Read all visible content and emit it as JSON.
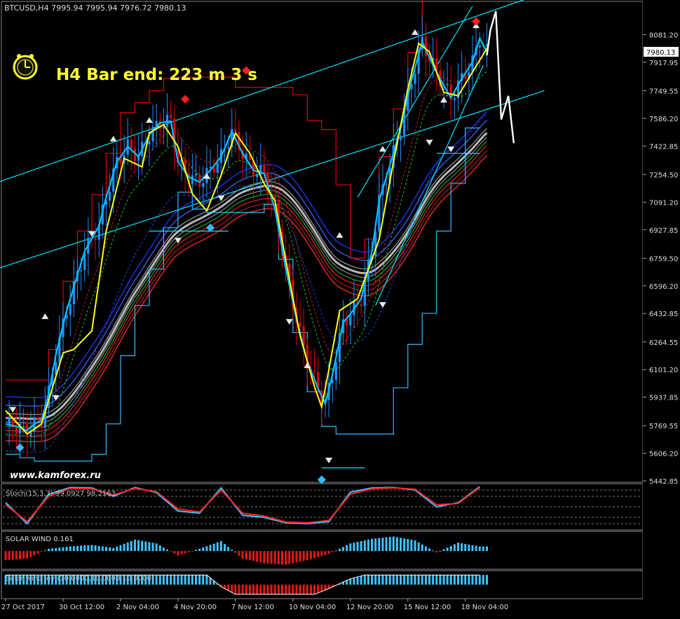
{
  "window": {
    "symbol_header": "BTCUSD,H4  7995.94 7995.94 7976.72 7980.13",
    "bar_end_label": "H4 Bar end: 223 m 3 s",
    "watermark": "www.kamforex.ru",
    "clock_icon": "clock-icon"
  },
  "colors": {
    "background": "#000000",
    "price_line": "#00bfff",
    "zigzag": "#ffff00",
    "channel": "#00e5ff",
    "envelope_upper": "#e00000",
    "envelope_lower": "#33bbff",
    "forecast": "#ffffff",
    "bull": "#1e90ff",
    "bear": "#e00000",
    "label_text": "#ffff33",
    "axis_text": "#dddddd"
  },
  "chart_data": [
    {
      "type": "line",
      "panel": "price",
      "ylim": [
        5442.85,
        8245.0
      ],
      "y_ticks": [
        8081.2,
        7917.95,
        7749.55,
        7586.2,
        7422.85,
        7254.5,
        7091.2,
        6927.85,
        6759.5,
        6596.2,
        6432.85,
        6264.55,
        6101.2,
        5937.85,
        5769.55,
        5606.2,
        5442.85
      ],
      "current_price": 7980.13,
      "x_ticks": [
        "27 Oct 2017",
        "30 Oct 12:00",
        "2 Nov 04:00",
        "4 Nov 20:00",
        "7 Nov 12:00",
        "10 Nov 04:00",
        "12 Nov 20:00",
        "15 Nov 12:00",
        "18 Nov 04:00"
      ],
      "x_range": [
        0,
        138
      ],
      "series": [
        {
          "role": "price",
          "x": [
            0,
            4,
            6,
            8,
            10,
            12,
            14,
            17,
            19,
            22,
            26,
            28,
            31,
            34,
            37,
            40,
            43,
            46,
            48,
            51,
            54,
            57,
            60,
            63,
            66,
            69,
            72,
            75,
            78,
            81,
            84,
            87,
            89,
            91,
            94,
            96,
            99,
            102,
            104,
            107,
            110,
            113,
            116,
            119,
            122,
            124,
            127,
            130,
            132,
            134
          ],
          "values": [
            5780,
            5760,
            5740,
            5780,
            5800,
            5960,
            6190,
            6450,
            6590,
            6800,
            6950,
            7120,
            7330,
            7420,
            7360,
            7490,
            7560,
            7570,
            7330,
            7240,
            7210,
            7280,
            7360,
            7510,
            7380,
            7280,
            7260,
            7050,
            6700,
            6400,
            6150,
            5990,
            5900,
            6070,
            6380,
            6430,
            6520,
            6800,
            7100,
            7310,
            7530,
            7810,
            8040,
            7900,
            7780,
            7710,
            7820,
            7920,
            8060,
            7980
          ]
        },
        {
          "role": "zigzag",
          "x": [
            0,
            6,
            10,
            16,
            19,
            24,
            28,
            33,
            38,
            40,
            44,
            48,
            52,
            56,
            60,
            64,
            68,
            72,
            75,
            78,
            82,
            86,
            88,
            90,
            93,
            98,
            104,
            108,
            112,
            115,
            118,
            122,
            126,
            130,
            134
          ],
          "values": [
            5860,
            5720,
            5780,
            6200,
            6220,
            6330,
            6920,
            7350,
            7300,
            7500,
            7550,
            7420,
            7140,
            7040,
            7250,
            7500,
            7380,
            7200,
            7100,
            6750,
            6300,
            6000,
            5880,
            6100,
            6450,
            6520,
            6870,
            7330,
            7760,
            8030,
            7980,
            7740,
            7720,
            7860,
            8000
          ]
        },
        {
          "role": "forecast",
          "x": [
            134,
            135,
            136.5,
            138,
            140,
            141.5
          ],
          "values": [
            7960,
            8110,
            8220,
            7580,
            7720,
            7440
          ]
        }
      ]
    },
    {
      "type": "line",
      "panel": "stochastic",
      "title": "Stoch(15,3,3) 99.0927 98.2163",
      "ylim": [
        0,
        100
      ],
      "y_ticks": [
        100,
        90,
        75,
        50,
        25,
        10,
        0
      ],
      "x": [
        0,
        6,
        12,
        18,
        24,
        30,
        36,
        42,
        48,
        54,
        60,
        66,
        72,
        78,
        84,
        90,
        96,
        102,
        108,
        114,
        120,
        126,
        132
      ],
      "series": [
        {
          "role": "main",
          "values": [
            60,
            10,
            80,
            96,
            95,
            75,
            96,
            84,
            40,
            35,
            95,
            30,
            25,
            12,
            10,
            15,
            85,
            95,
            96,
            90,
            50,
            60,
            98
          ]
        },
        {
          "role": "signal",
          "values": [
            55,
            15,
            75,
            94,
            93,
            78,
            94,
            86,
            45,
            38,
            90,
            35,
            28,
            14,
            12,
            18,
            80,
            93,
            95,
            92,
            55,
            58,
            96
          ]
        }
      ]
    },
    {
      "type": "bar",
      "panel": "solar_wind",
      "title": "SOLAR WIND 0.161",
      "ylim": [
        -2.2,
        2.3
      ],
      "y_ticks": [
        2.017,
        0.0,
        -1.725
      ],
      "x": [
        0,
        6,
        12,
        18,
        24,
        30,
        36,
        42,
        48,
        54,
        60,
        66,
        72,
        78,
        84,
        90,
        96,
        102,
        108,
        114,
        120,
        126,
        132
      ],
      "values": [
        -1.2,
        -1.0,
        0.3,
        0.6,
        0.8,
        0.4,
        1.5,
        1.0,
        -0.6,
        0.3,
        1.3,
        -1.0,
        -1.6,
        -1.8,
        -1.2,
        -0.4,
        1.0,
        1.6,
        1.9,
        1.4,
        -0.2,
        1.1,
        0.6
      ]
    },
    {
      "type": "bar",
      "panel": "solar_wind_joy",
      "title": "Solar wind joy (10.0000,10.0000,10.0000)",
      "ylim": [
        -13,
        13
      ],
      "y_ticks": [
        11,
        0,
        -11
      ],
      "x": [
        0,
        10,
        20,
        30,
        40,
        50,
        56,
        60,
        64,
        70,
        74,
        80,
        86,
        90,
        96,
        100,
        110,
        120,
        132
      ],
      "values": [
        10,
        10,
        10,
        10,
        10,
        10,
        10,
        -2,
        -10,
        -10,
        -10,
        -10,
        -10,
        -4,
        6,
        10,
        10,
        10,
        10
      ]
    }
  ]
}
